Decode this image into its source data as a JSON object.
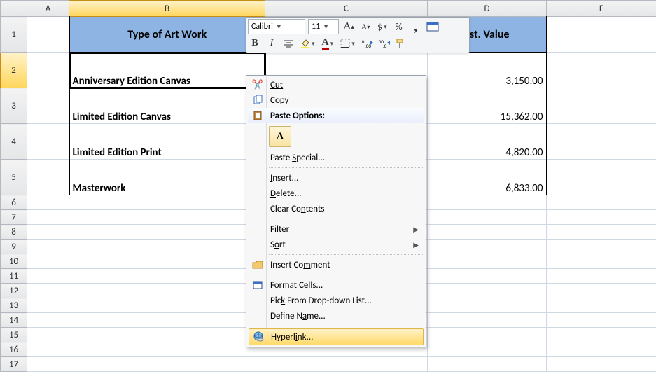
{
  "columns": [
    "A",
    "B",
    "C",
    "D",
    "E"
  ],
  "rowNums": [
    "1",
    "2",
    "3",
    "4",
    "5",
    "6",
    "7",
    "8",
    "9",
    "10",
    "11",
    "12",
    "13",
    "14",
    "15",
    "16",
    "17"
  ],
  "headers": {
    "B": "Type of Art Work",
    "D": "Est. Value"
  },
  "rows": [
    {
      "type": "Anniversary Edition Canvas",
      "value": "3,150.00"
    },
    {
      "type": "Limited Edition Canvas",
      "value": "15,362.00"
    },
    {
      "type": "Limited Edition Print",
      "value": "4,820.00"
    },
    {
      "type": "Masterwork",
      "value": "6,833.00"
    }
  ],
  "miniToolbar": {
    "font": "Calibri",
    "size": "11",
    "growFont": "A",
    "shrinkFont": "A",
    "currency": "$",
    "percent": "%",
    "comma": ",",
    "bold": "B",
    "italic": "I"
  },
  "contextMenu": {
    "cut": "Cut",
    "copy": "Copy",
    "pasteOptions": "Paste Options:",
    "pasteA": "A",
    "pasteSpecial": "Paste Special...",
    "insert": "Insert...",
    "delete": "Delete...",
    "clear": "Clear Contents",
    "filter": "Filter",
    "sort": "Sort",
    "insertComment": "Insert Comment",
    "formatCells": "Format Cells...",
    "pickList": "Pick From Drop-down List...",
    "defineName": "Define Name...",
    "hyperlink": "Hyperlink..."
  }
}
